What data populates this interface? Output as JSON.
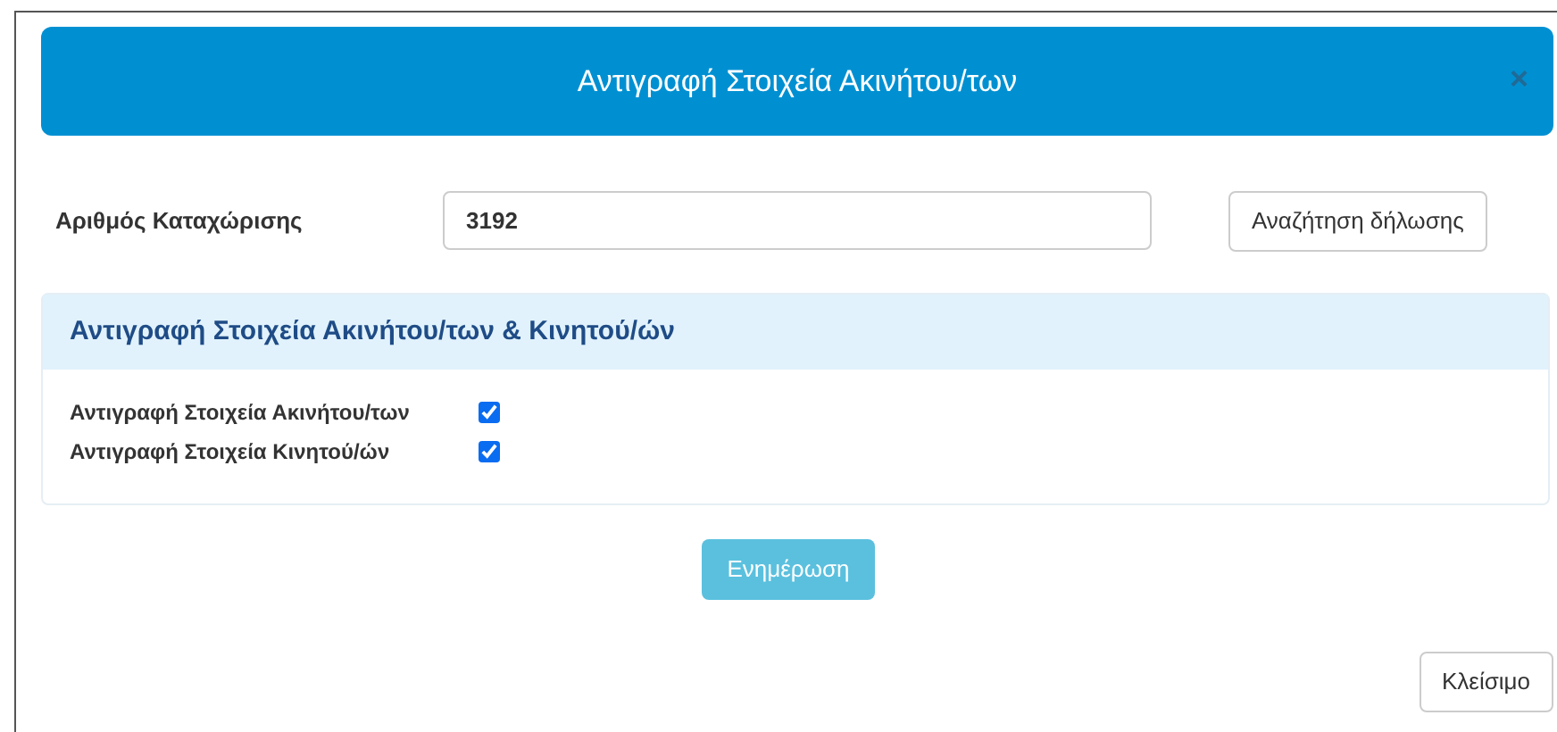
{
  "dialog": {
    "title": "Αντιγραφή Στοιχεία Ακινήτου/των",
    "close_glyph": "×"
  },
  "registration": {
    "label": "Αριθμός Καταχώρισης",
    "value": "3192",
    "search_button": "Αναζήτηση δήλωσης"
  },
  "panel": {
    "title": "Αντιγραφή Στοιχεία Ακινήτου/των & Κινητού/ών",
    "options": [
      {
        "label": "Αντιγραφή Στοιχεία Ακινήτου/των",
        "checked": true
      },
      {
        "label": "Αντιγραφή Στοιχεία Κινητού/ών",
        "checked": true
      }
    ]
  },
  "update_button": "Ενημέρωση",
  "close_button": "Κλείσιμο"
}
